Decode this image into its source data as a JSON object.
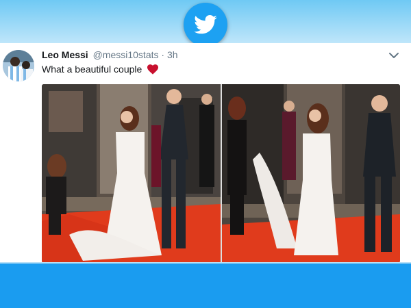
{
  "tweet": {
    "author_name": "Leo Messi",
    "handle": "@messi10stats",
    "separator": "·",
    "time": "3h",
    "text": "What a beautiful couple"
  },
  "icons": {
    "logo": "twitter-bird-icon",
    "menu": "chevron-down-icon",
    "emoji": "red-heart-icon"
  },
  "colors": {
    "twitter_blue": "#1da1f2",
    "heart_red": "#c8102e",
    "carpet_red": "#e03b1c"
  },
  "media": [
    {
      "name": "photo-left"
    },
    {
      "name": "photo-right"
    }
  ]
}
